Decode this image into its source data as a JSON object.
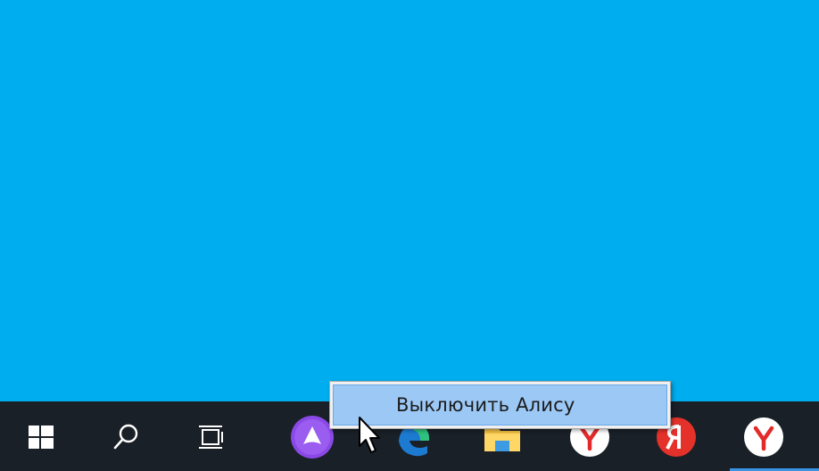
{
  "desktop": {
    "background_color": "#00adef"
  },
  "taskbar": {
    "background_color": "#1a2027",
    "accent_color": "#3a94e6",
    "items": [
      {
        "icon": "windows-start-icon"
      },
      {
        "icon": "search-icon"
      },
      {
        "icon": "task-view-icon"
      },
      {
        "icon": "alice-assistant-icon",
        "color": "#8a49e6"
      },
      {
        "icon": "edge-browser-icon"
      },
      {
        "icon": "file-explorer-icon"
      },
      {
        "icon": "yandex-browser-icon"
      },
      {
        "icon": "yandex-icon",
        "color": "#e4322a"
      },
      {
        "icon": "yandex-browser-icon"
      }
    ]
  },
  "context_menu": {
    "items": [
      {
        "label": "Выключить Алису",
        "highlighted": true
      }
    ]
  }
}
